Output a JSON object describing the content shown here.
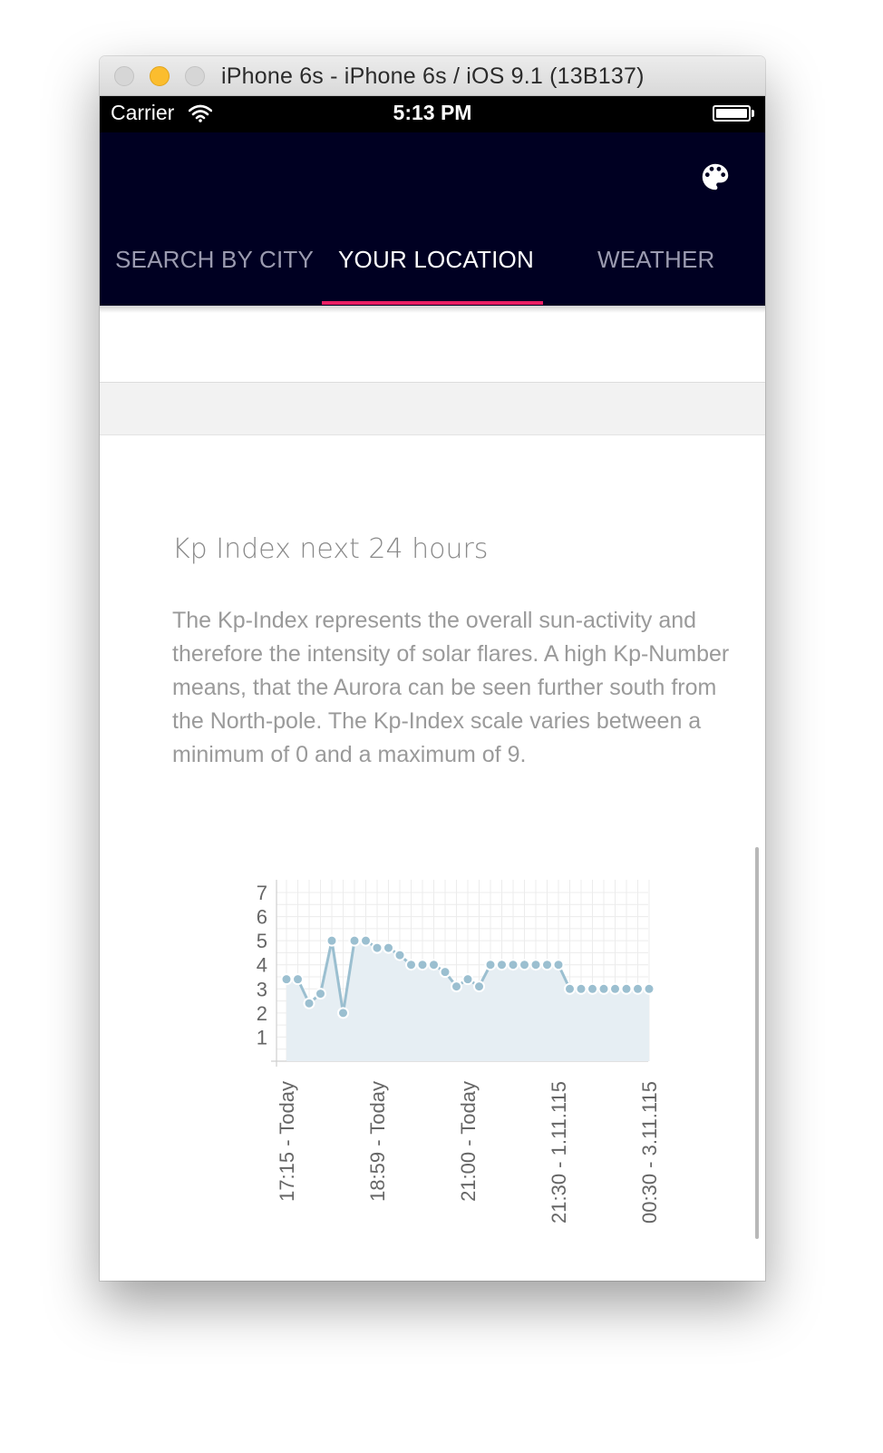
{
  "window": {
    "title": "iPhone 6s - iPhone 6s / iOS 9.1 (13B137)"
  },
  "status_bar": {
    "carrier": "Carrier",
    "time": "5:13 PM"
  },
  "app_bar": {
    "action_icon": "palette-icon",
    "tabs": [
      {
        "label": "SEARCH BY CITY",
        "active": false
      },
      {
        "label": "YOUR LOCATION",
        "active": true
      },
      {
        "label": "WEATHER",
        "active": false
      }
    ],
    "indicator_color": "#e91e63",
    "background_color": "#000022"
  },
  "kp": {
    "title": "Kp Index next 24 hours",
    "description": "The Kp-Index represents the overall sun-activity and therefore the intensity of solar flares. A high Kp-Number means, that the Aurora can be seen further south from the North-pole. The Kp-Index scale varies between a minimum of 0 and a maximum of 9."
  },
  "chart_data": {
    "type": "area",
    "title": "",
    "xlabel": "",
    "ylabel": "",
    "ylim": [
      0,
      7
    ],
    "y_ticks": [
      1,
      2,
      3,
      4,
      5,
      6,
      7
    ],
    "x_tick_labels": [
      "17:15 - Today",
      "18:59 - Today",
      "21:00 - Today",
      "21:30 - 1.11.115",
      "00:30 - 3.11.115"
    ],
    "x_tick_indices": [
      0,
      8,
      16,
      24,
      32
    ],
    "grid": true,
    "color": "#9bbfd0",
    "fill_color": "#e6eef3",
    "series": [
      {
        "values": [
          3.4,
          3.4,
          2.4,
          2.8,
          5.0,
          2.0,
          5.0,
          5.0,
          4.7,
          4.7,
          4.4,
          4.0,
          4.0,
          4.0,
          3.7,
          3.1,
          3.4,
          3.1,
          4.0,
          4.0,
          4.0,
          4.0,
          4.0,
          4.0,
          4.0,
          3.0,
          3.0,
          3.0,
          3.0,
          3.0,
          3.0,
          3.0,
          3.0
        ]
      }
    ]
  }
}
